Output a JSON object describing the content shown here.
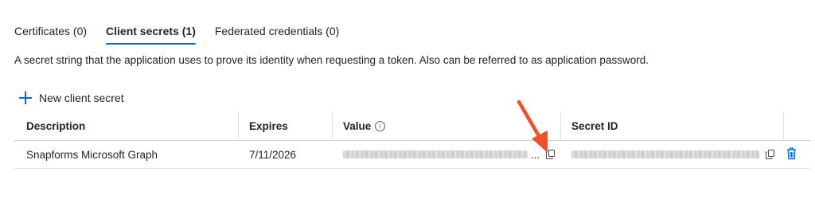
{
  "tabs": [
    {
      "label": "Certificates (0)"
    },
    {
      "label": "Client secrets (1)"
    },
    {
      "label": "Federated credentials (0)"
    }
  ],
  "active_tab": "Client secrets (1)",
  "description": "A secret string that the application uses to prove its identity when requesting a token. Also can be referred to as application password.",
  "actions": {
    "new_secret_label": "New client secret"
  },
  "table": {
    "columns": [
      "Description",
      "Expires",
      "Value",
      "Secret ID"
    ],
    "rows": [
      {
        "description": "Snapforms Microsoft Graph",
        "expires": "7/11/2026",
        "value_ellipsis": "..."
      }
    ]
  },
  "colors": {
    "accent": "#0f6cbd",
    "annotation_arrow": "#f0502a"
  },
  "icons": [
    "plus-icon",
    "info-icon",
    "copy-icon",
    "trash-icon",
    "arrow-annotation"
  ]
}
